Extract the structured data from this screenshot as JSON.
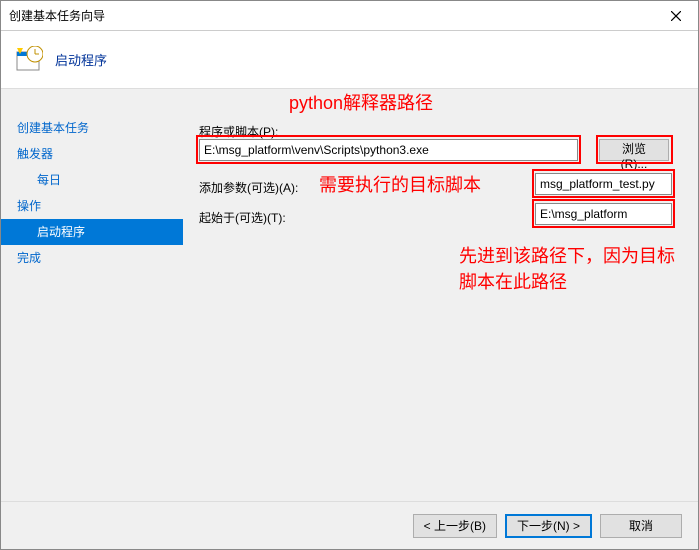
{
  "titlebar": {
    "title": "创建基本任务向导"
  },
  "header": {
    "title": "启动程序"
  },
  "sidebar": {
    "items": [
      {
        "label": "创建基本任务",
        "indent": false
      },
      {
        "label": "触发器",
        "indent": false
      },
      {
        "label": "每日",
        "indent": true
      },
      {
        "label": "操作",
        "indent": false
      },
      {
        "label": "启动程序",
        "indent": true,
        "selected": true
      },
      {
        "label": "完成",
        "indent": false
      }
    ]
  },
  "form": {
    "program_label": "程序或脚本(P):",
    "program_value": "E:\\msg_platform\\venv\\Scripts\\python3.exe",
    "browse_btn": "浏览(R)...",
    "args_label": "添加参数(可选)(A):",
    "args_value": "msg_platform_test.py",
    "startin_label": "起始于(可选)(T):",
    "startin_value": "E:\\msg_platform"
  },
  "annotations": {
    "a1": "python解释器路径",
    "a2": "需要执行的目标脚本",
    "a3": "先进到该路径下，因为目标脚本在此路径"
  },
  "footer": {
    "back": "< 上一步(B)",
    "next": "下一步(N) >",
    "cancel": "取消"
  }
}
